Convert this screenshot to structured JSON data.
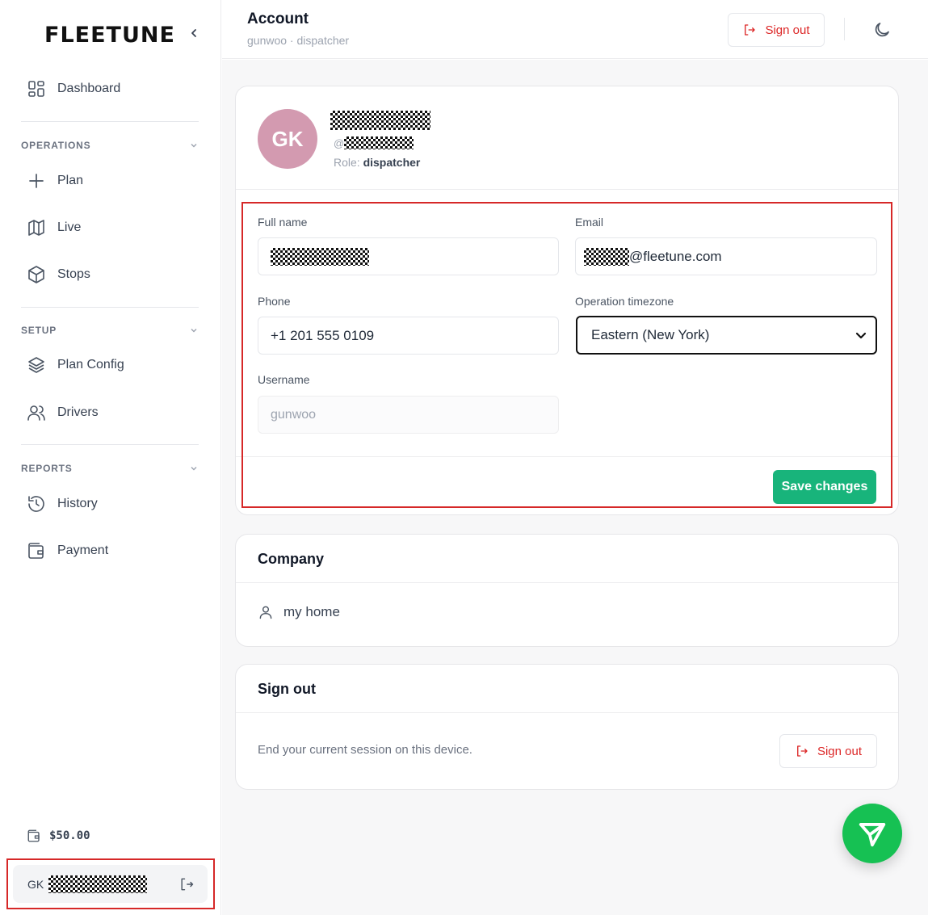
{
  "brand": {
    "logo": "FLEETUNE"
  },
  "sidebar": {
    "dashboard": "Dashboard",
    "sections": {
      "operations": "OPERATIONS",
      "setup": "SETUP",
      "reports": "REPORTS"
    },
    "items": {
      "plan": "Plan",
      "live": "Live",
      "stops": "Stops",
      "plan_config": "Plan Config",
      "drivers": "Drivers",
      "history": "History",
      "payment": "Payment"
    },
    "balance": "$50.00",
    "user": {
      "initials": "GK"
    }
  },
  "header": {
    "title": "Account",
    "subtitle": "gunwoo · dispatcher",
    "signout_label": "Sign out"
  },
  "profile": {
    "avatar_initials": "GK",
    "handle_prefix": "@",
    "role_label": "Role:",
    "role_value": "dispatcher"
  },
  "form": {
    "full_name_label": "Full name",
    "email_label": "Email",
    "email_domain": "@fleetune.com",
    "phone_label": "Phone",
    "phone_value": "+1 201 555 0109",
    "timezone_label": "Operation timezone",
    "timezone_value": "Eastern (New York)",
    "username_label": "Username",
    "username_value": "gunwoo",
    "save_label": "Save changes"
  },
  "company": {
    "title": "Company",
    "name": "my home"
  },
  "signout_card": {
    "title": "Sign out",
    "description": "End your current session on this device.",
    "button_label": "Sign out"
  },
  "colors": {
    "accent_green": "#18b47b",
    "fab_green": "#16c153",
    "danger_red": "#dc2626",
    "avatar_pink": "#d39ab0"
  }
}
